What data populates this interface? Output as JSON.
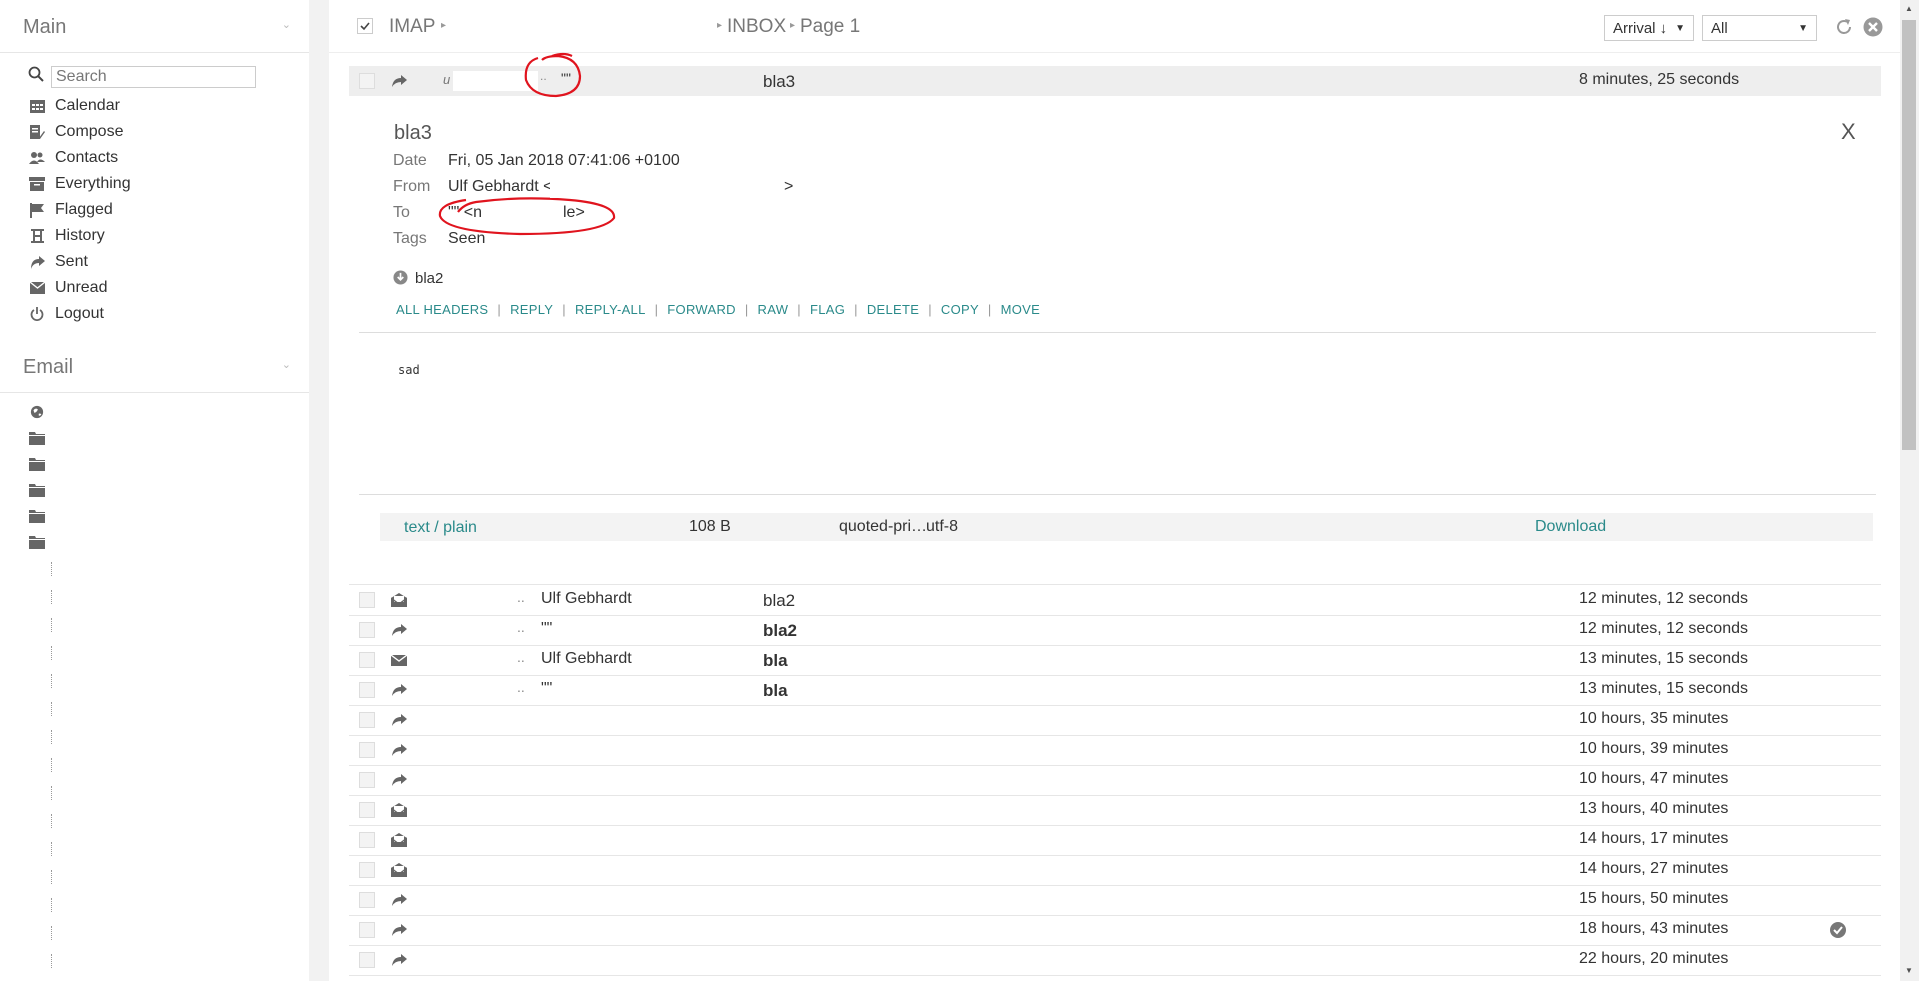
{
  "sidebar": {
    "main_title": "Main",
    "email_title": "Email",
    "search_placeholder": "Search",
    "items": [
      {
        "label": "Calendar",
        "icon": "calendar-icon"
      },
      {
        "label": "Compose",
        "icon": "compose-icon"
      },
      {
        "label": "Contacts",
        "icon": "contacts-icon"
      },
      {
        "label": "Everything",
        "icon": "everything-icon"
      },
      {
        "label": "Flagged",
        "icon": "flag-icon"
      },
      {
        "label": "History",
        "icon": "history-icon"
      },
      {
        "label": "Sent",
        "icon": "sent-icon"
      },
      {
        "label": "Unread",
        "icon": "unread-icon"
      },
      {
        "label": "Logout",
        "icon": "power-icon"
      }
    ]
  },
  "topbar": {
    "breadcrumb": [
      "IMAP",
      "INBOX",
      "Page 1"
    ],
    "sort_value": "Arrival ↓",
    "filter_value": "All"
  },
  "selected_row": {
    "from_prefix": "u",
    "from_quoted": "\"\"",
    "subject": "bla3",
    "date": "8 minutes, 25 seconds"
  },
  "message": {
    "title": "bla3",
    "headers": [
      {
        "label": "Date",
        "value": "Fri, 05 Jan 2018 07:41:06 +0100"
      },
      {
        "label": "From",
        "value": "Ulf Gebhardt <",
        "suffix": ">"
      },
      {
        "label": "To",
        "value": "\"\" <n",
        "suffix": "le>"
      },
      {
        "label": "Tags",
        "value": "Seen"
      }
    ],
    "thread_link": "bla2",
    "actions": [
      "ALL HEADERS",
      "REPLY",
      "REPLY-ALL",
      "FORWARD",
      "RAW",
      "FLAG",
      "DELETE",
      "COPY",
      "MOVE"
    ],
    "body": "sad",
    "part": {
      "mime": "text / plain",
      "size": "108 B",
      "encoding": "quoted-pri…",
      "charset": "utf-8",
      "download": "Download"
    },
    "close_label": "X"
  },
  "rows": [
    {
      "icon": "envelope-open-icon",
      "from": "Ulf Gebhardt",
      "subject": "bla2",
      "bold": false,
      "date": "12 minutes, 12 seconds"
    },
    {
      "icon": "reply-icon",
      "from": "\"\"",
      "subject": "bla2",
      "bold": true,
      "date": "12 minutes, 12 seconds"
    },
    {
      "icon": "envelope-icon",
      "from": "Ulf Gebhardt",
      "subject": "bla",
      "bold": true,
      "date": "13 minutes, 15 seconds"
    },
    {
      "icon": "reply-icon",
      "from": "\"\"",
      "subject": "bla",
      "bold": true,
      "date": "13 minutes, 15 seconds"
    },
    {
      "icon": "reply-icon",
      "from": "",
      "subject": "",
      "bold": false,
      "date": "10 hours, 35 minutes"
    },
    {
      "icon": "reply-icon",
      "from": "",
      "subject": "",
      "bold": false,
      "date": "10 hours, 39 minutes"
    },
    {
      "icon": "reply-icon",
      "from": "",
      "subject": "",
      "bold": false,
      "date": "10 hours, 47 minutes"
    },
    {
      "icon": "envelope-open-icon",
      "from": "",
      "subject": "",
      "bold": false,
      "date": "13 hours, 40 minutes"
    },
    {
      "icon": "envelope-open-icon",
      "from": "",
      "subject": "",
      "bold": false,
      "date": "14 hours, 17 minutes"
    },
    {
      "icon": "envelope-open-icon",
      "from": "",
      "subject": "",
      "bold": false,
      "date": "14 hours, 27 minutes"
    },
    {
      "icon": "reply-icon",
      "from": "",
      "subject": "",
      "bold": false,
      "date": "15 hours, 50 minutes"
    },
    {
      "icon": "reply-icon",
      "from": "",
      "subject": "",
      "bold": false,
      "date": "18 hours, 43 minutes",
      "check": true
    },
    {
      "icon": "reply-icon",
      "from": "",
      "subject": "",
      "bold": false,
      "date": "22 hours, 20 minutes"
    }
  ],
  "colors": {
    "accent": "#2a8a8a",
    "annotation": "#e0141e"
  }
}
